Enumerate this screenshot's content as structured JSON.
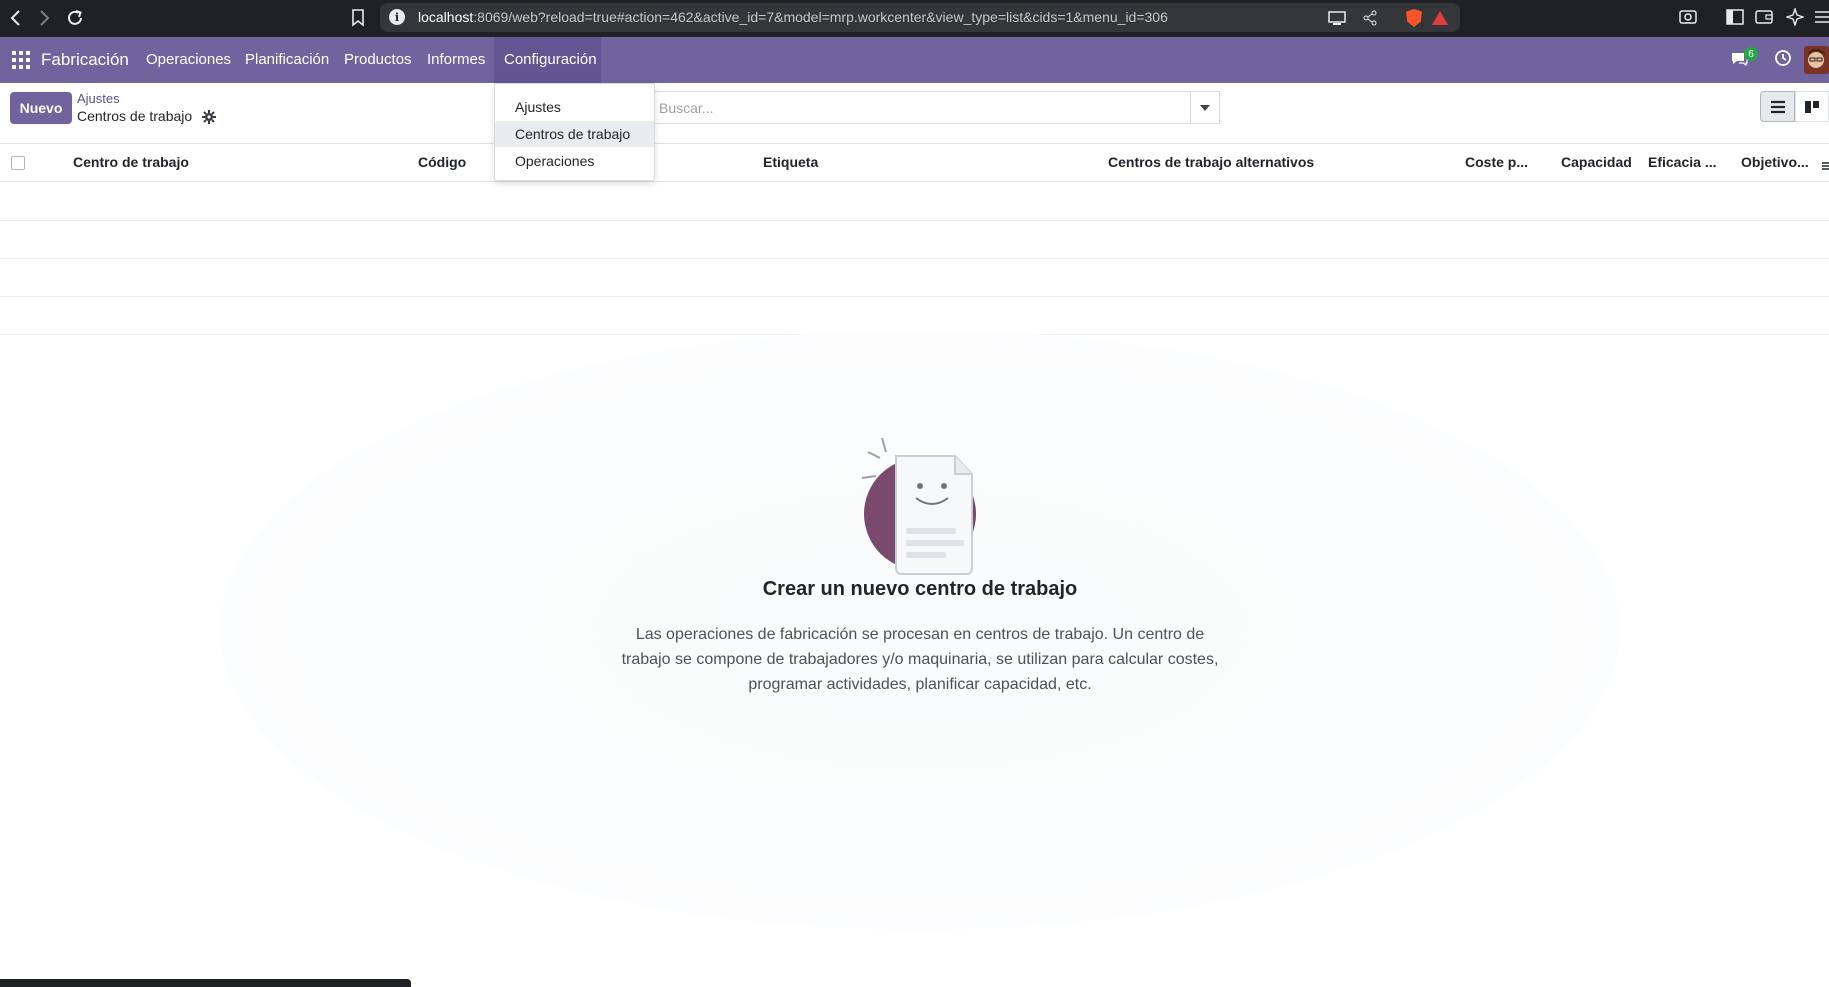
{
  "browser": {
    "url_host": "localhost",
    "url_rest": ":8069/web?reload=true#action=462&active_id=7&model=mrp.workcenter&view_type=list&cids=1&menu_id=306"
  },
  "navbar": {
    "app_name": "Fabricación",
    "menu": [
      "Operaciones",
      "Planificación",
      "Productos",
      "Informes",
      "Configuración"
    ],
    "chat_badge": "6",
    "accent_color": "#71639e"
  },
  "control": {
    "new_label": "Nuevo",
    "breadcrumb_parent": "Ajustes",
    "breadcrumb_current": "Centros de trabajo",
    "search_placeholder": "Buscar..."
  },
  "dropdown": {
    "items": [
      "Ajustes",
      "Centros de trabajo",
      "Operaciones"
    ],
    "active_item": "Centros de trabajo"
  },
  "table": {
    "columns": [
      "Centro de trabajo",
      "Código",
      "Etiqueta",
      "Centros de trabajo alternativos",
      "Coste p...",
      "Capacidad",
      "Eficacia ...",
      "Objetivo..."
    ]
  },
  "empty_state": {
    "title": "Crear un nuevo centro de trabajo",
    "description": "Las operaciones de fabricación se procesan en centros de trabajo. Un centro de trabajo se compone de trabajadores y/o maquinaria, se utilizan para calcular costes, programar actividades, planificar capacidad, etc."
  }
}
